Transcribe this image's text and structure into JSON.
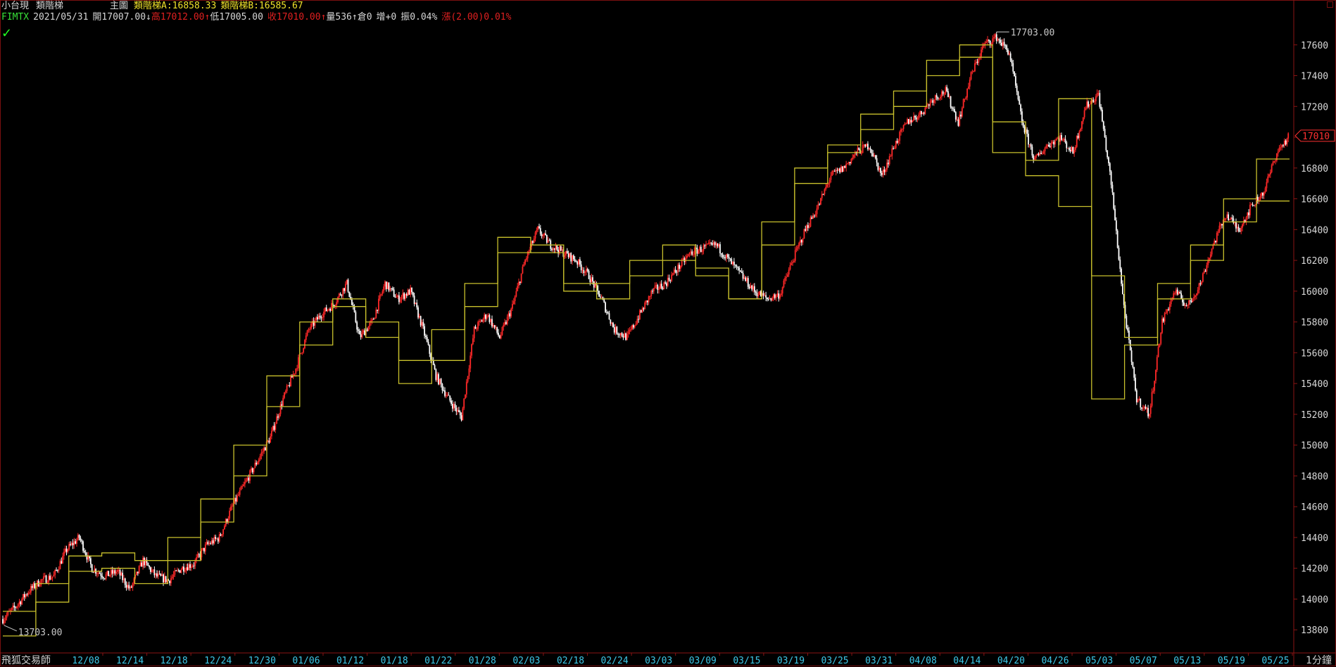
{
  "header": {
    "symbol": "小台現",
    "indicator": "類階梯",
    "panel": "主圖",
    "lineA": "類階梯A:16858.33",
    "lineB": "類階梯B:16585.67"
  },
  "quote": {
    "code": "FIMTX",
    "date": "2021/05/31",
    "open": "開17007.00",
    "open_arrow": "↓",
    "high": "高17012.00",
    "high_arrow": "↑",
    "low": "低17005.00",
    "close": "收17010.00",
    "close_arrow": "↑",
    "volume": "量536",
    "volume_arrow": "↑",
    "oi": "倉0",
    "oi_change": "增+0",
    "amplitude": "振0.04%",
    "change": "漲(2.00)0.01%"
  },
  "footer": {
    "brand": "飛狐交易師",
    "timeframe": "1分鐘"
  },
  "colors": {
    "background": "#000000",
    "up": "#ff2828",
    "down": "#ffffff",
    "step_line": "#c8c02c",
    "axis": "#8a1414",
    "date_label": "#3ec8e8",
    "price_label": "#d8d8d8"
  },
  "chart_data": {
    "type": "candlestick",
    "ylim": [
      13650,
      17800
    ],
    "yticks": [
      13800,
      14000,
      14200,
      14400,
      14600,
      14800,
      15000,
      15200,
      15400,
      15600,
      15800,
      16000,
      16200,
      16400,
      16600,
      16800,
      17000,
      17200,
      17400,
      17600
    ],
    "xlabels": [
      "12/08",
      "12/14",
      "12/18",
      "12/24",
      "12/30",
      "01/06",
      "01/12",
      "01/18",
      "01/22",
      "01/28",
      "02/03",
      "02/18",
      "02/24",
      "03/03",
      "03/09",
      "03/15",
      "03/19",
      "03/25",
      "03/31",
      "04/08",
      "04/14",
      "04/20",
      "04/26",
      "05/03",
      "05/07",
      "05/13",
      "05/19",
      "05/25"
    ],
    "max_label": "17703.00",
    "min_label": "13703.00",
    "last_price": "17010",
    "price_path": [
      13870,
      13950,
      14050,
      14120,
      14150,
      14320,
      14400,
      14200,
      14150,
      14180,
      14060,
      14250,
      14150,
      14120,
      14200,
      14230,
      14350,
      14400,
      14600,
      14750,
      14900,
      15050,
      15300,
      15500,
      15750,
      15850,
      15920,
      16050,
      15700,
      15800,
      16050,
      15950,
      16000,
      15750,
      15450,
      15300,
      15180,
      15750,
      15850,
      15700,
      15900,
      16200,
      16400,
      16300,
      16250,
      16200,
      16100,
      15950,
      15750,
      15700,
      15850,
      16000,
      16050,
      16150,
      16250,
      16280,
      16300,
      16200,
      16100,
      16000,
      15950,
      15980,
      16200,
      16400,
      16550,
      16750,
      16800,
      16900,
      16950,
      16750,
      16950,
      17100,
      17150,
      17250,
      17300,
      17100,
      17400,
      17600,
      17650,
      17550,
      17100,
      16850,
      16950,
      17000,
      16900,
      17200,
      17280,
      16700,
      15900,
      15300,
      15200,
      15800,
      16000,
      15900,
      16050,
      16300,
      16500,
      16400,
      16550,
      16650,
      16900,
      17010
    ],
    "series": [
      {
        "name": "類階梯A",
        "step_values": [
          13920,
          14100,
          14280,
          14300,
          14250,
          14400,
          14650,
          15000,
          15450,
          15800,
          15950,
          15800,
          15550,
          15750,
          16050,
          16350,
          16250,
          16000,
          16050,
          16200,
          16300,
          16150,
          15950,
          16450,
          16800,
          16950,
          17150,
          17300,
          17500,
          17600,
          17100,
          16850,
          17250,
          16100,
          15700,
          16050,
          16300,
          16600,
          16858.33
        ]
      },
      {
        "name": "類階梯B",
        "step_values": [
          13760,
          13980,
          14180,
          14200,
          14100,
          14250,
          14500,
          14800,
          15250,
          15650,
          15900,
          15700,
          15400,
          15550,
          15900,
          16250,
          16300,
          16050,
          15950,
          16100,
          16200,
          16100,
          15950,
          16300,
          16700,
          16900,
          17050,
          17200,
          17400,
          17520,
          16900,
          16750,
          16550,
          15300,
          15650,
          15950,
          16200,
          16450,
          16585.67
        ]
      }
    ]
  }
}
